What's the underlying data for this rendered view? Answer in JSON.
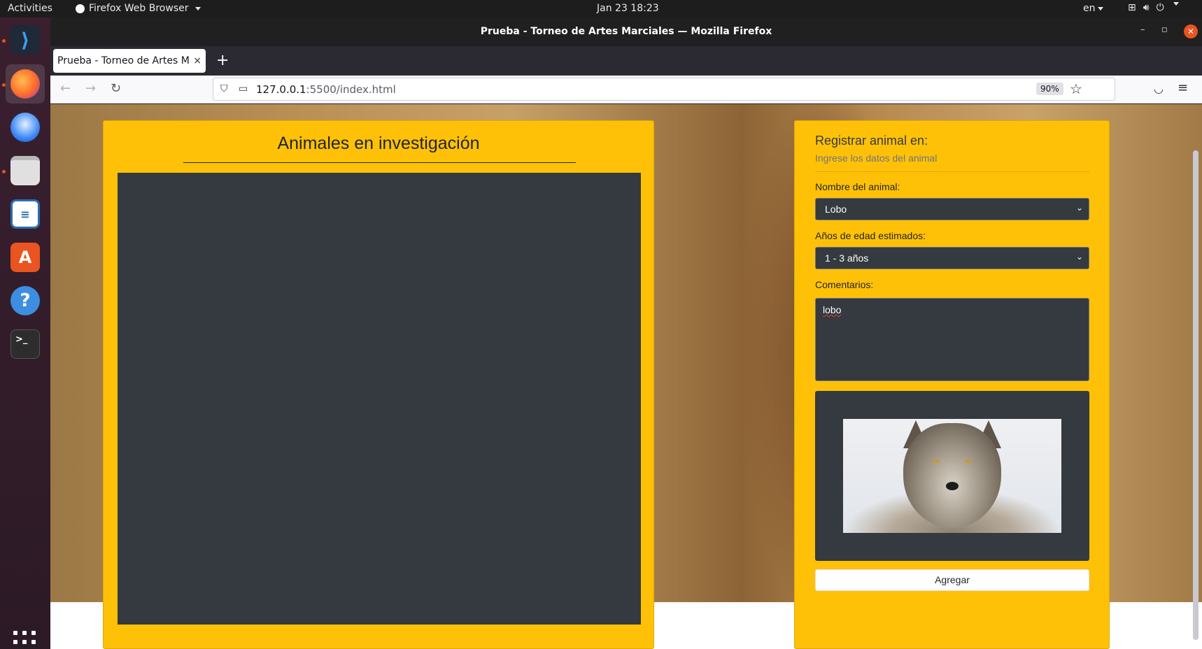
{
  "topbar": {
    "activities": "Activities",
    "app_menu": "Firefox Web Browser",
    "clock": "Jan 23  18:23",
    "lang": "en"
  },
  "dock": {
    "items": [
      "vscode",
      "firefox",
      "thunderbird",
      "files",
      "writer",
      "software",
      "help",
      "terminal"
    ]
  },
  "window": {
    "title": "Prueba - Torneo de Artes Marciales — Mozilla Firefox"
  },
  "tab": {
    "title": "Prueba - Torneo de Artes Ma",
    "close": "×",
    "new_tab": "+"
  },
  "nav": {
    "url_host": "127.0.0.1",
    "url_path": ":5500/index.html",
    "zoom": "90%"
  },
  "page": {
    "left_title": "Animales en investigación",
    "form_title": "Registrar animal en:",
    "form_subtitle": "Ingrese los datos del animal",
    "name_label": "Nombre del animal:",
    "name_value": "Lobo",
    "age_label": "Años de edad estimados:",
    "age_value": "1 - 3 años",
    "comments_label": "Comentarios:",
    "comments_value": "lobo",
    "add_button": "Agregar"
  },
  "colors": {
    "panel": "#ffc107",
    "dark": "#343a40",
    "accent": "#e95420"
  }
}
